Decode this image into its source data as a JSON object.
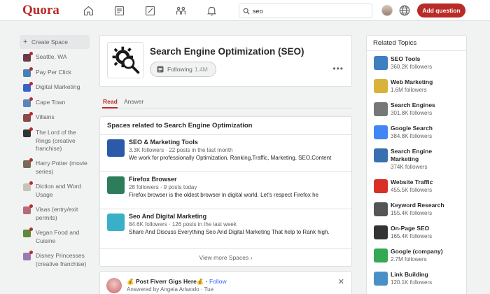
{
  "header": {
    "logo": "Quora",
    "search_value": "seo",
    "add_question_label": "Add question",
    "icons": [
      "home-icon",
      "answer-icon",
      "edit-icon",
      "spaces-icon",
      "bell-icon",
      "search-icon",
      "globe-icon"
    ]
  },
  "sidebar": {
    "create_space_label": "Create Space",
    "items": [
      {
        "label": "Seattle, WA",
        "color": "#6b3a4a"
      },
      {
        "label": "Pay Per Click",
        "color": "#4a7fb5"
      },
      {
        "label": "Digital Marketing",
        "color": "#3b62c9"
      },
      {
        "label": "Cape Town",
        "color": "#5b84b8"
      },
      {
        "label": "Villains",
        "color": "#8a4a4a"
      },
      {
        "label": "The Lord of the Rings (creative franchise)",
        "color": "#333333"
      },
      {
        "label": "Harry Potter (movie series)",
        "color": "#7a6a5a"
      },
      {
        "label": "Diction and Word Usage",
        "color": "#c8c2ba"
      },
      {
        "label": "Visas (entry/exit permits)",
        "color": "#b56a7a"
      },
      {
        "label": "Vegan Food and Cuisine",
        "color": "#5a8a3a"
      },
      {
        "label": "Disney Princesses (creative franchise)",
        "color": "#9a7ab5"
      }
    ]
  },
  "topic": {
    "title": "Search Engine Optimization (SEO)",
    "following_label": "Following",
    "following_count": "1.4M"
  },
  "tabs": [
    {
      "label": "Read",
      "active": true
    },
    {
      "label": "Answer",
      "active": false
    }
  ],
  "spaces": {
    "title": "Spaces related to Search Engine Optimization",
    "items": [
      {
        "name": "SEO & Marketing Tools",
        "meta": "3.3K followers · 22 posts in the last month",
        "desc": "We work for professionally Optimization, Ranking,Traffic, Marketing, SEO,Content",
        "color": "#2a5aa8"
      },
      {
        "name": "Firefox Browser",
        "meta": "28 followers · 9 posts today",
        "desc": "Firefox browser is the oldest browser in digital world. Let's respect Firefox he",
        "color": "#2e7d5a"
      },
      {
        "name": "Seo And Digital Marketing",
        "meta": "84.6K followers · 126 posts in the last week",
        "desc": "Share And Discuss Everything Seo And Digital Marketing That help to Rank high.",
        "color": "#3ab0c8"
      }
    ],
    "view_more_label": "View more Spaces ›"
  },
  "post": {
    "title": "💰 Post Fiverr Gigs Here💰",
    "follow_label": "Follow",
    "subtitle": "Answered by Angela Ariwodo · Tue"
  },
  "related": {
    "title": "Related Topics",
    "items": [
      {
        "name": "SEO Tools",
        "count": "360.2K followers",
        "color": "#3f7fbf"
      },
      {
        "name": "Web Marketing",
        "count": "1.6M followers",
        "color": "#d9b23a"
      },
      {
        "name": "Search Engines",
        "count": "301.8K followers",
        "color": "#777777"
      },
      {
        "name": "Google Search",
        "count": "384.8K followers",
        "color": "#4285f4"
      },
      {
        "name": "Search Engine Marketing",
        "count": "374K followers",
        "color": "#3a6fb0"
      },
      {
        "name": "Website Traffic",
        "count": "455.5K followers",
        "color": "#d93025"
      },
      {
        "name": "Keyword Research",
        "count": "155.4K followers",
        "color": "#555555"
      },
      {
        "name": "On-Page SEO",
        "count": "165.4K followers",
        "color": "#333333"
      },
      {
        "name": "Google (company)",
        "count": "2.7M followers",
        "color": "#34a853"
      },
      {
        "name": "Link Building",
        "count": "120.1K followers",
        "color": "#4a90c8"
      }
    ]
  }
}
